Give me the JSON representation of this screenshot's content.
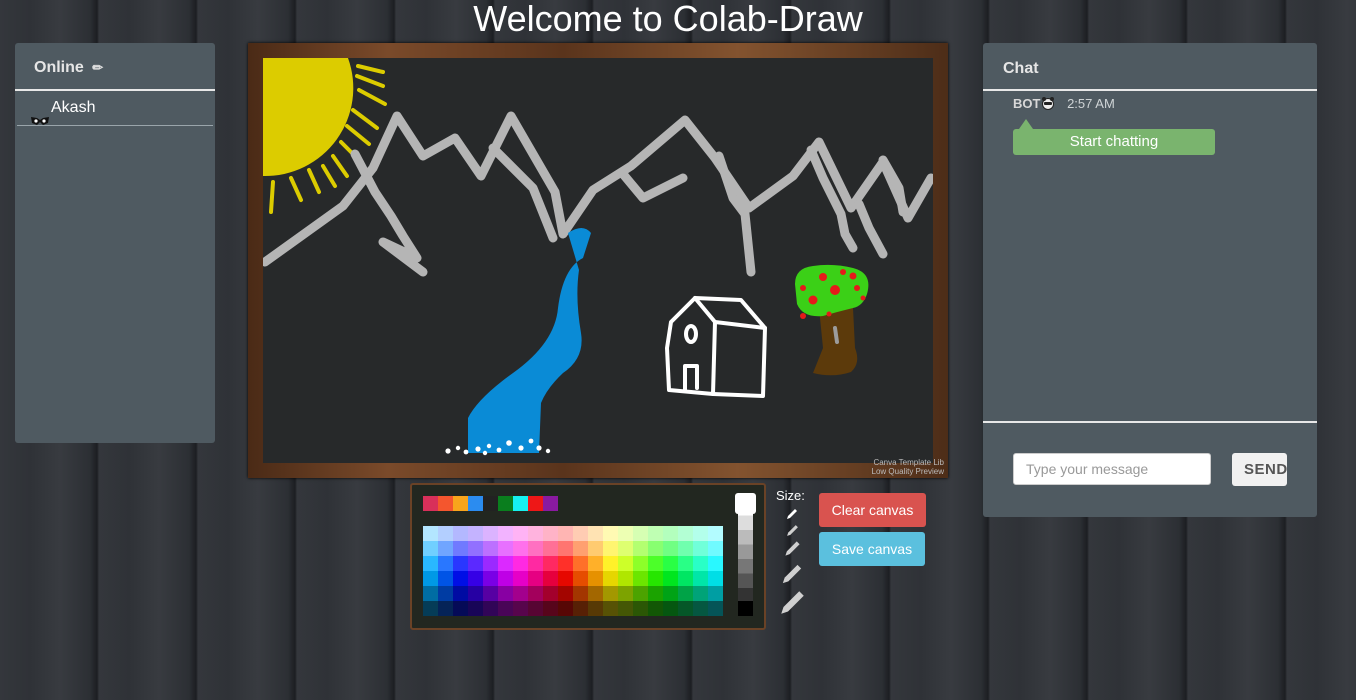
{
  "header": {
    "title": "Welcome to Colab-Draw"
  },
  "online": {
    "title": "Online",
    "pencil_glyph": "✏",
    "users": [
      {
        "name": "Akash",
        "icon": "mask-icon"
      }
    ]
  },
  "canvas": {
    "watermark_line1": "Canva Template Lib",
    "watermark_line2": "Low Quality Preview"
  },
  "palette": {
    "quick_colors": [
      "#d8305a",
      "#f4562e",
      "#f8a51c",
      "#2b8cf0",
      "#222222",
      "#0a7e1e",
      "#16f0f0",
      "#ee1717",
      "#8a1aa0"
    ],
    "size_label": "Size:"
  },
  "actions": {
    "clear_label": "Clear canvas",
    "save_label": "Save canvas"
  },
  "chat": {
    "title": "Chat",
    "messages": [
      {
        "sender": "BOT",
        "time": "2:57 AM",
        "text": "Start chatting"
      }
    ],
    "input_placeholder": "Type your message",
    "send_label": "SEND"
  },
  "colors": {
    "panel": "#4f5a61",
    "clear": "#d9534f",
    "save": "#5bc0de",
    "bubble": "#7ab46e"
  }
}
